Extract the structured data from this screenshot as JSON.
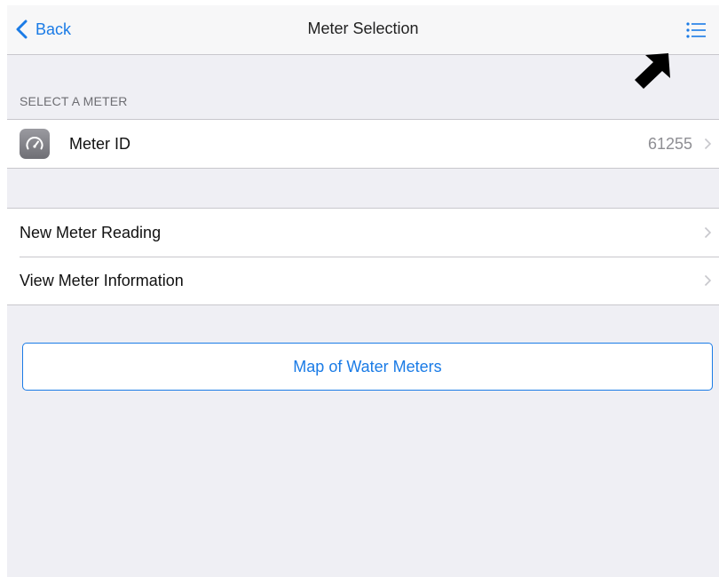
{
  "navbar": {
    "back_label": "Back",
    "title": "Meter Selection",
    "menu_icon": "list-icon"
  },
  "annotation": {
    "icon": "arrow-pointer-icon"
  },
  "section": {
    "header": "SELECT A METER"
  },
  "meter_row": {
    "icon": "speedometer-icon",
    "label": "Meter ID",
    "value": "61255"
  },
  "actions": [
    {
      "label": "New Meter Reading"
    },
    {
      "label": "View Meter Information"
    }
  ],
  "map_button": {
    "label": "Map of Water Meters"
  },
  "colors": {
    "accent": "#1a7be6",
    "background": "#efeff4",
    "separator": "#c8c7cc",
    "secondary_text": "#8e8e93"
  }
}
